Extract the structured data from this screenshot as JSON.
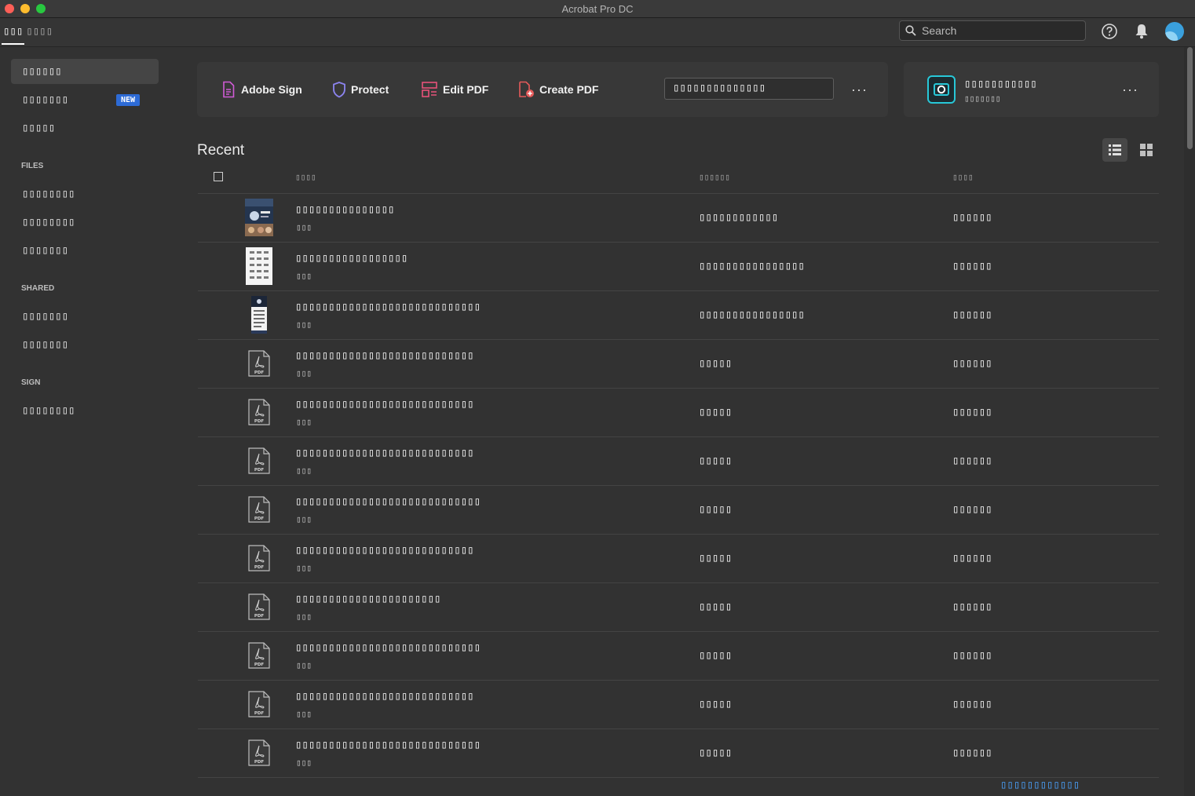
{
  "window": {
    "title": "Acrobat Pro DC"
  },
  "tabs": [
    {
      "label": "▯▯▯"
    },
    {
      "label": "▯▯▯▯"
    }
  ],
  "search": {
    "placeholder": "Search"
  },
  "sidebar": {
    "items": [
      {
        "label": "▯▯▯▯▯▯"
      },
      {
        "label": "▯▯▯▯▯▯▯",
        "badge": "NEW"
      },
      {
        "label": "▯▯▯▯▯"
      }
    ],
    "files_heading": "FILES",
    "files": [
      {
        "label": "▯▯▯▯▯▯▯▯"
      },
      {
        "label": "▯▯▯▯▯▯▯▯"
      },
      {
        "label": "▯▯▯▯▯▯▯"
      }
    ],
    "shared_heading": "SHARED",
    "shared": [
      {
        "label": "▯▯▯▯▯▯▯"
      },
      {
        "label": "▯▯▯▯▯▯▯"
      }
    ],
    "sign_heading": "SIGN",
    "sign": [
      {
        "label": "▯▯▯▯▯▯▯▯"
      }
    ]
  },
  "tools": {
    "adobe_sign": "Adobe Sign",
    "protect": "Protect",
    "edit_pdf": "Edit PDF",
    "create_pdf": "Create PDF",
    "search_tools": "▯▯▯▯▯▯▯▯▯▯▯▯▯▯",
    "more": "···"
  },
  "promo": {
    "title": "▯▯▯▯▯▯▯▯▯▯▯",
    "subtitle": "▯▯▯▯▯▯▯",
    "more": "···"
  },
  "recent": {
    "title": "Recent",
    "columns": {
      "name": "▯▯▯▯",
      "shared": "▯▯▯▯▯▯",
      "opened": "▯▯▯▯"
    },
    "rows": [
      {
        "name": "▯▯▯▯▯▯▯▯▯▯▯▯▯▯▯",
        "type": "▯▯▯",
        "shared": "▯▯▯▯▯▯▯▯▯▯▯▯",
        "opened": "▯▯▯▯▯▯",
        "thumb": "photo"
      },
      {
        "name": "▯▯▯▯▯▯▯▯▯▯▯▯▯▯▯▯▯",
        "type": "▯▯▯",
        "shared": "▯▯▯▯▯▯▯▯▯▯▯▯▯▯▯▯",
        "opened": "▯▯▯▯▯▯",
        "thumb": "doc"
      },
      {
        "name": "▯▯▯▯▯▯▯▯▯▯▯▯▯▯▯▯▯▯▯▯▯▯▯▯▯▯▯▯",
        "type": "▯▯▯",
        "shared": "▯▯▯▯▯▯▯▯▯▯▯▯▯▯▯▯",
        "opened": "▯▯▯▯▯▯",
        "thumb": "poster"
      },
      {
        "name": "▯▯▯▯▯▯▯▯▯▯▯▯▯▯▯▯▯▯▯▯▯▯▯▯▯▯▯",
        "type": "▯▯▯",
        "shared": "▯▯▯▯▯",
        "opened": "▯▯▯▯▯▯",
        "thumb": "pdf"
      },
      {
        "name": "▯▯▯▯▯▯▯▯▯▯▯▯▯▯▯▯▯▯▯▯▯▯▯▯▯▯▯",
        "type": "▯▯▯",
        "shared": "▯▯▯▯▯",
        "opened": "▯▯▯▯▯▯",
        "thumb": "pdf"
      },
      {
        "name": "▯▯▯▯▯▯▯▯▯▯▯▯▯▯▯▯▯▯▯▯▯▯▯▯▯▯▯",
        "type": "▯▯▯",
        "shared": "▯▯▯▯▯",
        "opened": "▯▯▯▯▯▯",
        "thumb": "pdf"
      },
      {
        "name": "▯▯▯▯▯▯▯▯▯▯▯▯▯▯▯▯▯▯▯▯▯▯▯▯▯▯▯▯",
        "type": "▯▯▯",
        "shared": "▯▯▯▯▯",
        "opened": "▯▯▯▯▯▯",
        "thumb": "pdf"
      },
      {
        "name": "▯▯▯▯▯▯▯▯▯▯▯▯▯▯▯▯▯▯▯▯▯▯▯▯▯▯▯",
        "type": "▯▯▯",
        "shared": "▯▯▯▯▯",
        "opened": "▯▯▯▯▯▯",
        "thumb": "pdf"
      },
      {
        "name": "▯▯▯▯▯▯▯▯▯▯▯▯▯▯▯▯▯▯▯▯▯▯",
        "type": "▯▯▯",
        "shared": "▯▯▯▯▯",
        "opened": "▯▯▯▯▯▯",
        "thumb": "pdf"
      },
      {
        "name": "▯▯▯▯▯▯▯▯▯▯▯▯▯▯▯▯▯▯▯▯▯▯▯▯▯▯▯▯",
        "type": "▯▯▯",
        "shared": "▯▯▯▯▯",
        "opened": "▯▯▯▯▯▯",
        "thumb": "pdf"
      },
      {
        "name": "▯▯▯▯▯▯▯▯▯▯▯▯▯▯▯▯▯▯▯▯▯▯▯▯▯▯▯",
        "type": "▯▯▯",
        "shared": "▯▯▯▯▯",
        "opened": "▯▯▯▯▯▯",
        "thumb": "pdf"
      },
      {
        "name": "▯▯▯▯▯▯▯▯▯▯▯▯▯▯▯▯▯▯▯▯▯▯▯▯▯▯▯▯",
        "type": "▯▯▯",
        "shared": "▯▯▯▯▯",
        "opened": "▯▯▯▯▯▯",
        "thumb": "pdf"
      }
    ]
  },
  "footer_link": "▯▯▯▯▯▯▯▯▯▯▯▯",
  "colors": {
    "accent": "#2d6bd6",
    "link": "#4aa3ff",
    "promo_accent": "#28c8d8",
    "background": "#323232"
  }
}
